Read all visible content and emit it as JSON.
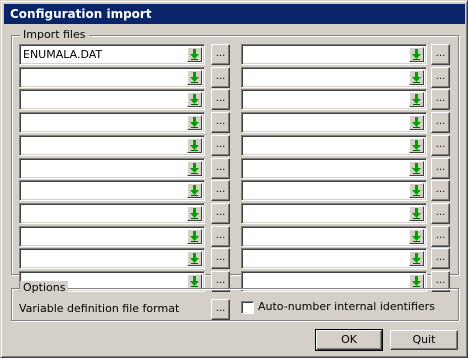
{
  "dialog": {
    "title": "Configuration import",
    "titlebar_color": "#0a246a"
  },
  "import_files": {
    "label": "Import files",
    "browse_label": "...",
    "drop_icon": "green-down-arrow-icon",
    "left_column": [
      "ENUMALA.DAT",
      "",
      "",
      "",
      "",
      "",
      "",
      "",
      "",
      "",
      ""
    ],
    "right_column": [
      "",
      "",
      "",
      "",
      "",
      "",
      "",
      "",
      "",
      "",
      ""
    ]
  },
  "options": {
    "label": "Options",
    "variable_definition_label": "Variable definition file format",
    "browse_label": "...",
    "auto_number_label": "Auto-number internal identifiers",
    "auto_number_checked": false
  },
  "buttons": {
    "ok_label": "OK",
    "quit_label": "Quit"
  }
}
